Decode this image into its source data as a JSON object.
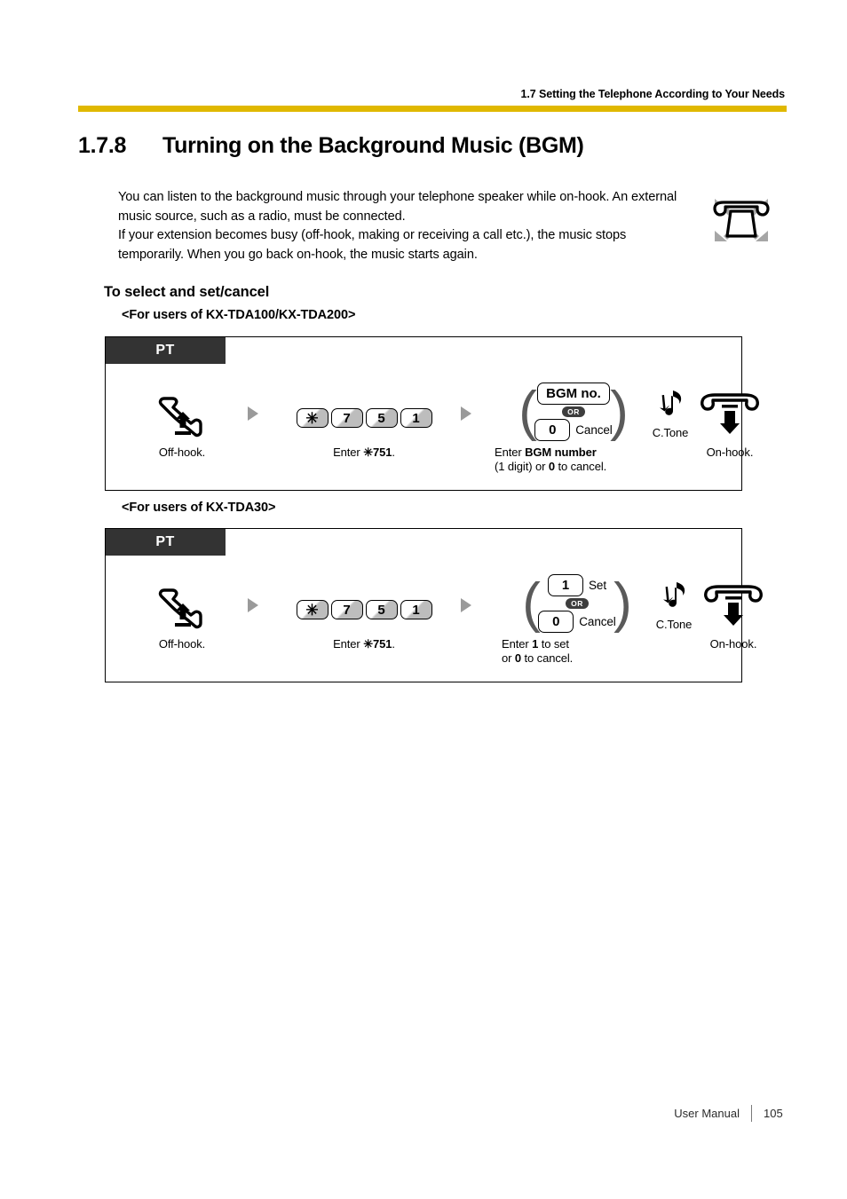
{
  "header": {
    "running_head": "1.7 Setting the Telephone According to Your Needs",
    "rule_color": "#e0b800"
  },
  "section": {
    "number": "1.7.8",
    "title": "Turning on the Background Music (BGM)"
  },
  "intro": {
    "paragraph_1": "You can listen to the background music through your telephone speaker while on-hook. An external music source, such as a radio, must be connected.",
    "paragraph_2": "If your extension becomes busy (off-hook, making or receiving a call etc.), the music stops temporarily. When you go back on-hook, the music starts again."
  },
  "phone_type_icon": {
    "name": "telephone-with-x-icon"
  },
  "headings": {
    "to_select": "To select and set/cancel",
    "users_tda100_200": "<For users of KX-TDA100/KX-TDA200>",
    "users_tda30": "<For users of KX-TDA30>"
  },
  "flow_1": {
    "tab_label": "PT",
    "step_offhook": {
      "icon": "handset-off-hook-icon",
      "caption": "Off-hook."
    },
    "step_enter": {
      "keys": [
        "✳",
        "7",
        "5",
        "1"
      ],
      "caption_prefix": "Enter ",
      "caption_code": "✳751",
      "caption_suffix": "."
    },
    "step_bgm": {
      "option_1_label": "BGM no.",
      "or_label": "OR",
      "option_2_key": "0",
      "option_2_label": "Cancel",
      "caption_line1_prefix": "Enter ",
      "caption_line1_bold": "BGM number",
      "caption_line2_a": "(1 digit) or ",
      "caption_line2_bold": "0",
      "caption_line2_b": " to cancel."
    },
    "step_ctone": {
      "icon": "confirmation-tone-icon",
      "label": "C.Tone"
    },
    "step_onhook": {
      "icon": "handset-on-hook-icon",
      "caption": "On-hook."
    }
  },
  "flow_2": {
    "tab_label": "PT",
    "step_offhook": {
      "icon": "handset-off-hook-icon",
      "caption": "Off-hook."
    },
    "step_enter": {
      "keys": [
        "✳",
        "7",
        "5",
        "1"
      ],
      "caption_prefix": "Enter ",
      "caption_code": "✳751",
      "caption_suffix": "."
    },
    "step_setcancel": {
      "option_1_key": "1",
      "option_1_label": "Set",
      "or_label": "OR",
      "option_2_key": "0",
      "option_2_label": "Cancel",
      "caption_line1_a": "Enter ",
      "caption_line1_bold": "1",
      "caption_line1_b": " to set",
      "caption_line2_a": "or ",
      "caption_line2_bold": "0",
      "caption_line2_b": " to cancel."
    },
    "step_ctone": {
      "icon": "confirmation-tone-icon",
      "label": "C.Tone"
    },
    "step_onhook": {
      "icon": "handset-on-hook-icon",
      "caption": "On-hook."
    }
  },
  "footer": {
    "manual_label": "User Manual",
    "page_number": "105"
  }
}
